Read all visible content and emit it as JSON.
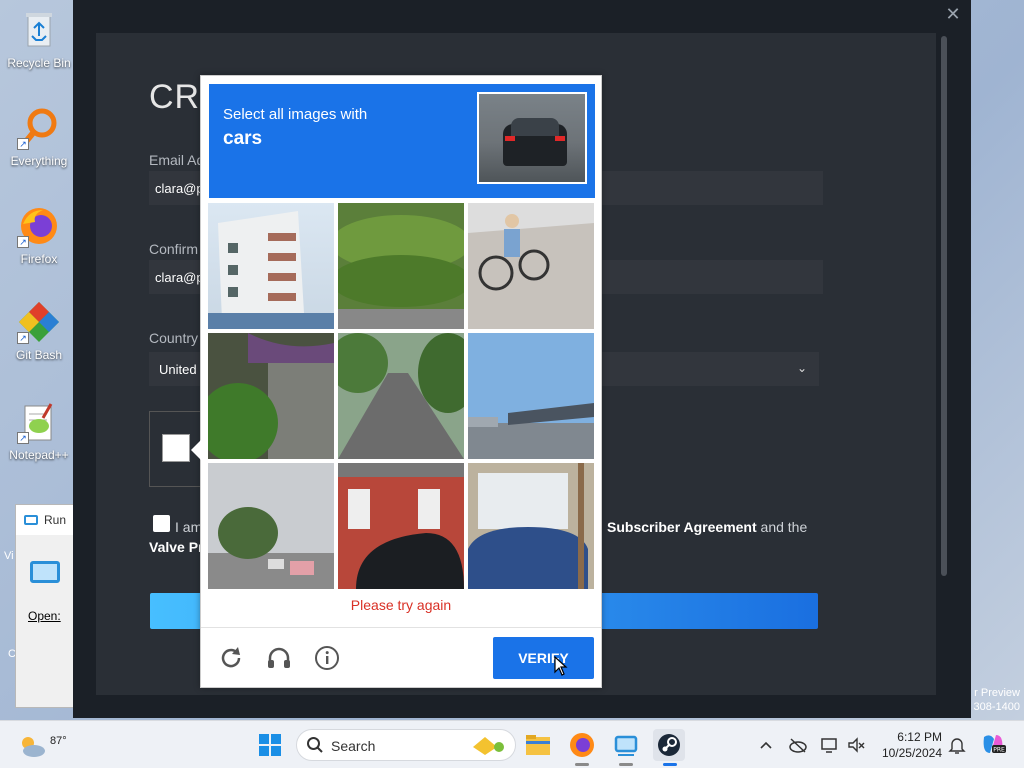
{
  "desktop": {
    "icons": [
      {
        "label": "Recycle Bin"
      },
      {
        "label": "Everything"
      },
      {
        "label": "Firefox"
      },
      {
        "label": "Git Bash"
      },
      {
        "label": "Notepad++"
      }
    ],
    "partial_left_text_1": "Vi",
    "partial_left_text_2": "C",
    "watermark_line1": "r Preview",
    "watermark_line2": "308-1400"
  },
  "run_dialog": {
    "title": "Run",
    "open_label": "Open:"
  },
  "steam_form": {
    "title_partial": "CRI",
    "email_label": "Email Ad",
    "email_value": "clara@p",
    "confirm_label": "Confirm",
    "confirm_value": "clara@p",
    "country_label": "Country",
    "country_value": "United",
    "agree_prefix": "I am",
    "agree_subscriber": "Subscriber Agreement",
    "agree_and_the": "and the",
    "valve_privacy": "Valve Pr",
    "close_glyph": "✕",
    "chevron_glyph": "⌄"
  },
  "recaptcha": {
    "instruction": "Select all images with",
    "target": "cars",
    "error": "Please try again",
    "verify_label": "VERIFY"
  },
  "taskbar": {
    "weather_temp": "87°",
    "search_label": "Search",
    "time": "6:12 PM",
    "date": "10/25/2024"
  },
  "colors": {
    "accent": "#1a73e8",
    "error": "#d93025",
    "steam_bg": "#1b2027"
  }
}
